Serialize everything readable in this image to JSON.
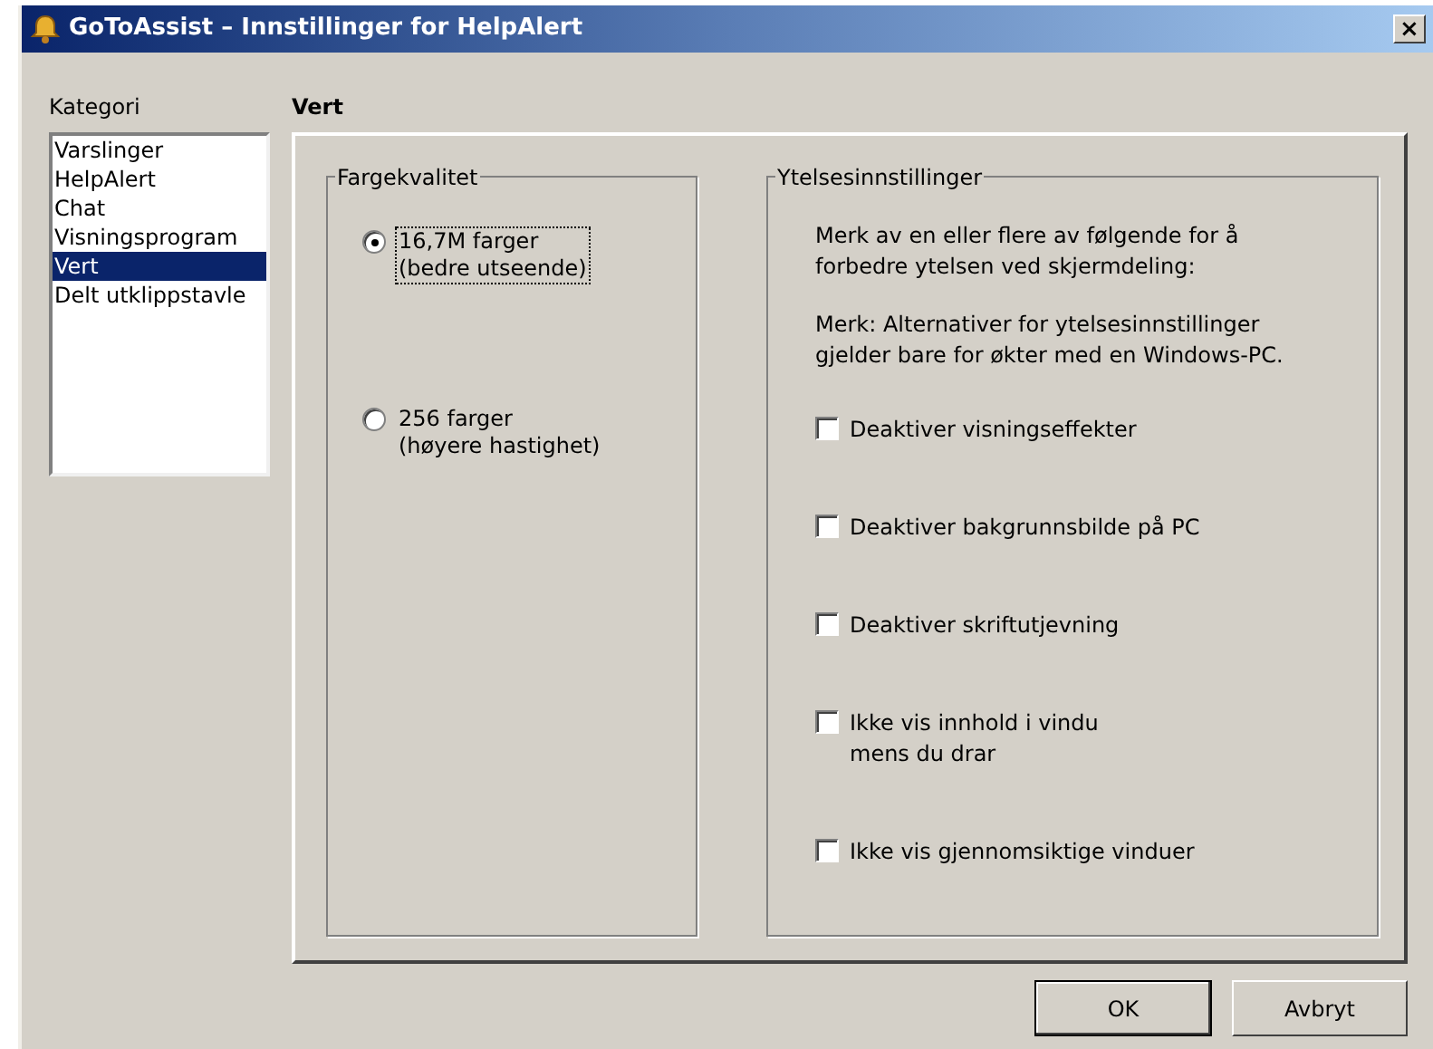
{
  "window": {
    "title": "GoToAssist – Innstillinger for HelpAlert",
    "close": "×"
  },
  "sidebar": {
    "label": "Kategori",
    "items": [
      {
        "label": "Varslinger",
        "selected": false
      },
      {
        "label": "HelpAlert",
        "selected": false
      },
      {
        "label": "Chat",
        "selected": false
      },
      {
        "label": "Visningsprogram",
        "selected": false
      },
      {
        "label": "Vert",
        "selected": true
      },
      {
        "label": "Delt utklippstavle",
        "selected": false
      }
    ]
  },
  "page_title": "Vert",
  "color_quality": {
    "legend": "Fargekvalitet",
    "options": [
      {
        "lines": [
          "16,7M farger",
          "(bedre utseende)"
        ],
        "selected": true
      },
      {
        "lines": [
          "256 farger",
          "(høyere hastighet)"
        ],
        "selected": false
      }
    ]
  },
  "performance": {
    "legend": "Ytelsesinnstillinger",
    "intro": "Merk av en eller flere av følgende for å forbedre ytelsen ved skjermdeling:",
    "note": "Merk: Alternativer for ytelsesinnstillinger gjelder bare for økter med en Windows-PC.",
    "options": [
      {
        "lines": [
          "Deaktiver visningseffekter"
        ],
        "checked": false
      },
      {
        "lines": [
          "Deaktiver bakgrunnsbilde på PC"
        ],
        "checked": false
      },
      {
        "lines": [
          "Deaktiver skriftutjevning"
        ],
        "checked": false
      },
      {
        "lines": [
          "Ikke vis innhold i vindu",
          "mens du drar"
        ],
        "checked": false
      },
      {
        "lines": [
          "Ikke vis gjennomsiktige vinduer"
        ],
        "checked": false
      }
    ]
  },
  "buttons": [
    {
      "label": "OK"
    },
    {
      "label": "Avbryt"
    }
  ]
}
